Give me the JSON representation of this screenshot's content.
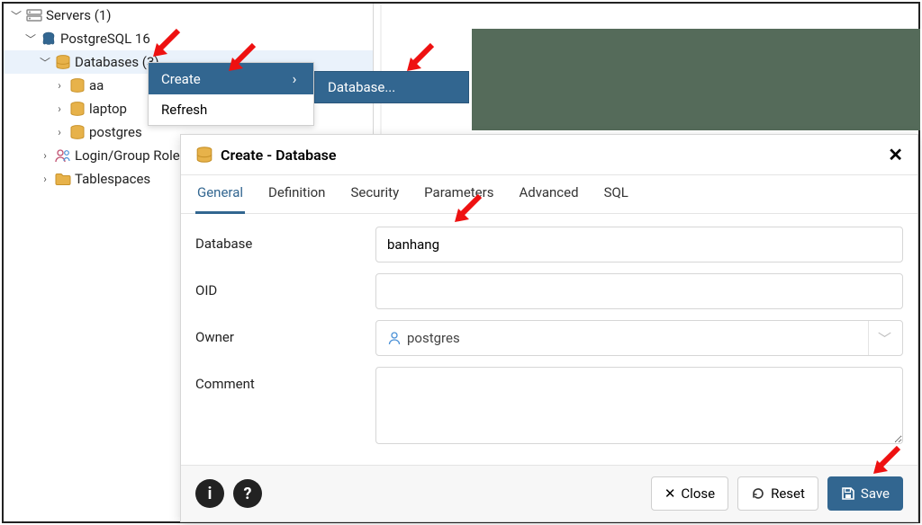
{
  "tree": {
    "root": "Servers (1)",
    "server": "PostgreSQL 16",
    "databases_label": "Databases (3)",
    "db1": "aa",
    "db2": "laptop",
    "db3": "postgres",
    "login_roles": "Login/Group Roles",
    "tablespaces": "Tablespaces"
  },
  "context_menu": {
    "create": "Create",
    "refresh": "Refresh",
    "submenu_database": "Database..."
  },
  "dialog": {
    "title": "Create - Database",
    "tabs": {
      "general": "General",
      "definition": "Definition",
      "security": "Security",
      "parameters": "Parameters",
      "advanced": "Advanced",
      "sql": "SQL"
    },
    "fields": {
      "database_label": "Database",
      "database_value": "banhang",
      "oid_label": "OID",
      "oid_value": "",
      "owner_label": "Owner",
      "owner_value": "postgres",
      "comment_label": "Comment",
      "comment_value": ""
    },
    "buttons": {
      "close": "Close",
      "reset": "Reset",
      "save": "Save"
    }
  }
}
